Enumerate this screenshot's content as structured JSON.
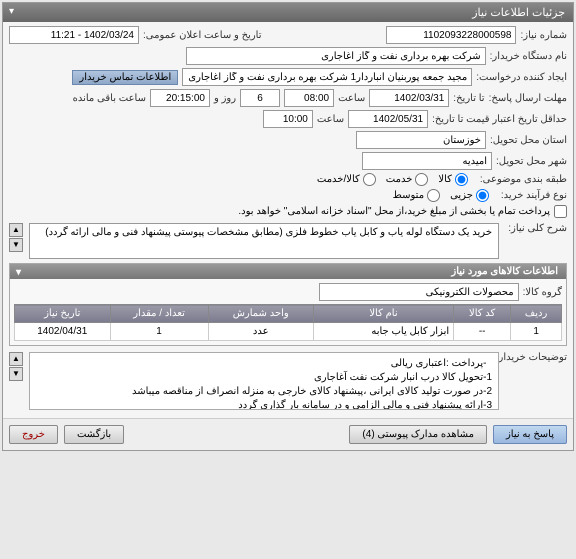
{
  "panel": {
    "title": "جزئیات اطلاعات نیاز"
  },
  "fields": {
    "need_number": {
      "label": "شماره نیاز:",
      "value": "1102093228000598"
    },
    "announcement": {
      "label": "تاریخ و ساعت اعلان عمومی:",
      "value": "1402/03/24 - 11:21"
    },
    "buyer_name": {
      "label": "نام دستگاه خریدار:",
      "value": "شرکت بهره برداری نفت و گاز اغاجاری"
    },
    "requester": {
      "label": "ایجاد کننده درخواست:",
      "value": "مجید جمعه پوربنیان انباردار1 شرکت بهره برداری نفت و گاز اغاجاری"
    },
    "contact_btn": "اطلاعات تماس خریدار",
    "deadline": {
      "label": "مهلت ارسال پاسخ:",
      "label2": "تا تاریخ:",
      "date": "1402/03/31",
      "time_lbl": "ساعت",
      "time": "08:00",
      "days": "6",
      "day_lbl": "روز و",
      "remain_time": "20:15:00",
      "remain_lbl": "ساعت باقی مانده"
    },
    "credit_deadline": {
      "label": "حداقل تاریخ اعتبار قیمت تا تاریخ:",
      "date": "1402/05/31",
      "time_lbl": "ساعت",
      "time": "10:00"
    },
    "province": {
      "label": "استان محل تحویل:",
      "value": "خوزستان"
    },
    "city": {
      "label": "شهر محل تحویل:",
      "value": "امیدیه"
    },
    "category": {
      "label": "طبقه بندی موضوعی:",
      "opts": [
        "کالا",
        "خدمت",
        "کالا/خدمت"
      ]
    },
    "process": {
      "label": "نوع فرآیند خرید:",
      "opts": [
        "جزیی",
        "متوسط"
      ]
    },
    "payment_note": "پرداخت تمام یا بخشی از مبلغ خرید،از محل \"اسناد خزانه اسلامی\" خواهد بود.",
    "desc": {
      "label": "شرح کلی نیاز:",
      "value": "خرید یک دستگاه لوله یاب و کابل یاب خطوط فلزی (مطابق مشخصات پیوستی پیشنهاد فنی و مالی ارائه گردد)"
    }
  },
  "goods": {
    "title": "اطلاعات کالاهای مورد نیاز",
    "group_lbl": "گروه کالا:",
    "group_value": "محصولات الکترونیکی",
    "columns": [
      "ردیف",
      "کد کالا",
      "نام کالا",
      "واحد شمارش",
      "تعداد / مقدار",
      "تاریخ نیاز"
    ],
    "rows": [
      {
        "idx": "1",
        "code": "--",
        "name": "ابزار کابل یاب جابه",
        "unit": "عدد",
        "qty": "1",
        "date": "1402/04/31"
      }
    ]
  },
  "buyer_notes": {
    "label": "توضیحات خریدار:",
    "value": "  -پرداخت :اعتباری ریالی\n1-تحویل کالا درب انبار شرکت نفت آغاجاری\n2-در صورت تولید کالای ایرانی ،پیشنهاد کالای خارجی به منزله انصراف از مناقصه میباشد\n3-ارائه پیشنهاد فنی و مالی الزامی و در سامانه بار گذاری گردد"
  },
  "buttons": {
    "respond": "پاسخ به نیاز",
    "attachments": "مشاهده مدارک پیوستی (4)",
    "back": "بازگشت",
    "exit": "خروج"
  }
}
